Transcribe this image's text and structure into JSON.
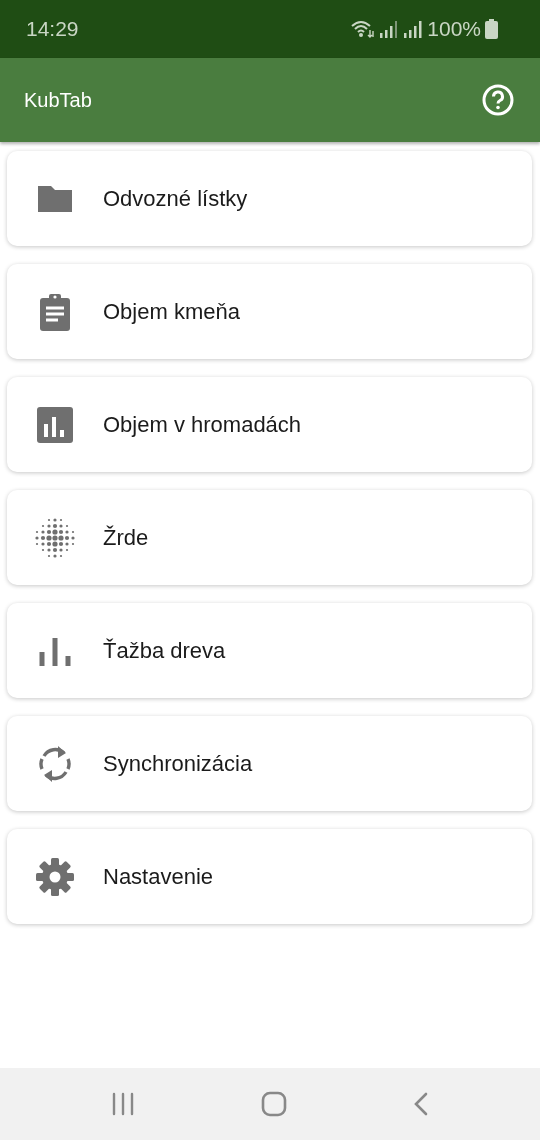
{
  "status_bar": {
    "time": "14:29",
    "battery": "100%"
  },
  "app_bar": {
    "title": "KubTab"
  },
  "menu": [
    {
      "label": "Odvozné lístky"
    },
    {
      "label": "Objem kmeňa"
    },
    {
      "label": "Objem v hromadách"
    },
    {
      "label": "Žrde"
    },
    {
      "label": "Ťažba dreva"
    },
    {
      "label": "Synchronizácia"
    },
    {
      "label": "Nastavenie"
    }
  ]
}
